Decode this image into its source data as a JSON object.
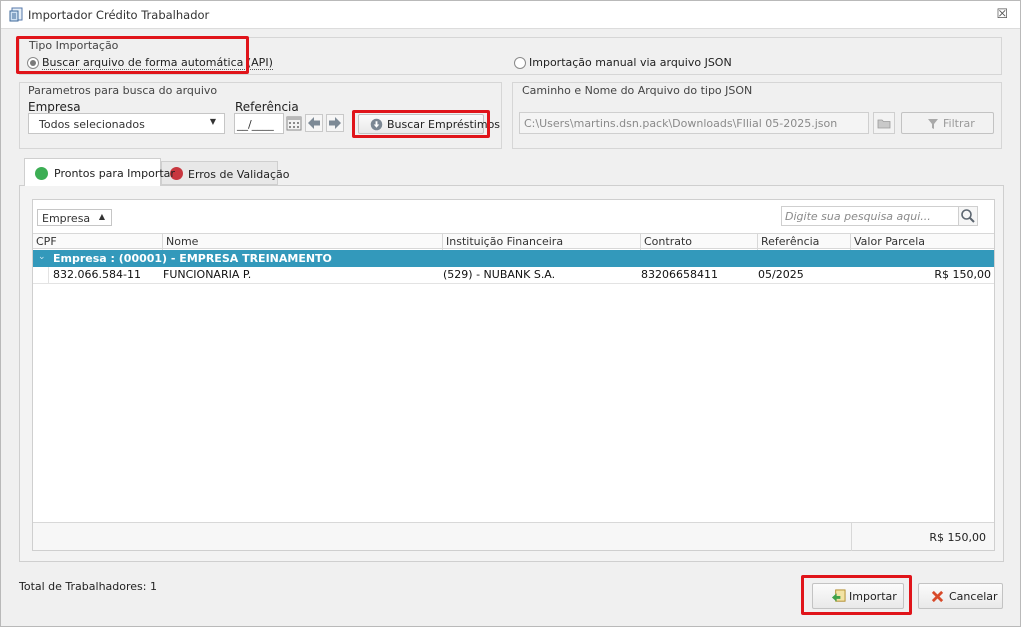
{
  "window": {
    "title": "Importador Crédito Trabalhador",
    "close_glyph": "☒"
  },
  "tipo_importacao": {
    "group_title": "Tipo Importação",
    "option_api": "Buscar arquivo de forma automática (API)",
    "option_json": "Importação manual via arquivo JSON",
    "selected": "api"
  },
  "parametros": {
    "group_title": "Parametros para busca do arquivo",
    "empresa_label": "Empresa",
    "empresa_value": "Todos selecionados",
    "referencia_label": "Referência",
    "referencia_value": "__/____",
    "buscar_button": "Buscar Empréstimos"
  },
  "caminho": {
    "group_title": "Caminho e Nome do Arquivo do tipo JSON",
    "path_value": "C:\\Users\\martins.dsn.pack\\Downloads\\FIlial 05-2025.json",
    "filtrar_button": "Filtrar"
  },
  "tabs": [
    {
      "label": "Prontos para Importar",
      "color": "#3cae54",
      "active": true
    },
    {
      "label": "Erros de Validação",
      "color": "#c8373f",
      "active": false
    }
  ],
  "grid": {
    "group_by_label": "Empresa",
    "search_placeholder": "Digite sua pesquisa aqui...",
    "columns": [
      "CPF",
      "Nome",
      "Instituição Financeira",
      "Contrato",
      "Referência",
      "Valor Parcela"
    ],
    "group_row_label": "Empresa : (00001) - EMPRESA TREINAMENTO",
    "group_row_color": "#3399bb",
    "rows": [
      {
        "cpf": "832.066.584-11",
        "nome": "FUNCIONARIA P.",
        "instituicao": "(529) - NUBANK S.A.",
        "contrato": "83206658411",
        "referencia": "05/2025",
        "valor": "R$ 150,00"
      }
    ],
    "footer_total": "R$ 150,00"
  },
  "footer": {
    "total_label": "Total de Trabalhadores: 1",
    "importar_button": "Importar",
    "cancelar_button": "Cancelar"
  }
}
